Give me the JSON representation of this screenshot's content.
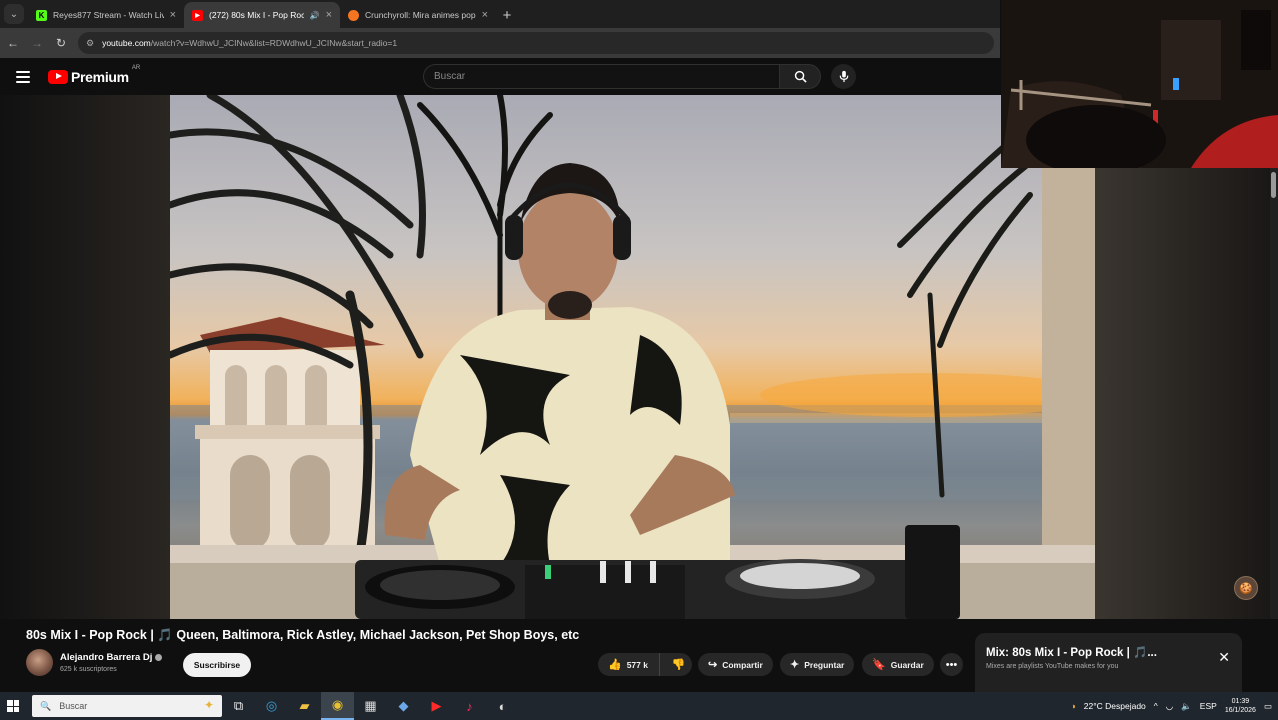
{
  "browser": {
    "tabs": [
      {
        "title": "Reyes877 Stream - Watch Live o",
        "favicon": "kick-icon",
        "active": false
      },
      {
        "title": "(272) 80s Mix I - Pop Rock |",
        "favicon": "youtube-icon",
        "active": true
      },
      {
        "title": "Crunchyroll: Mira animes popu",
        "favicon": "crunchyroll-icon",
        "active": false
      }
    ],
    "url_host": "youtube.com",
    "url_rest": "/watch?v=WdhwU_JCINw&list=RDWdhwU_JCINw&start_radio=1"
  },
  "youtube": {
    "brand": "Premium",
    "region": "AR",
    "search_placeholder": "Buscar"
  },
  "video": {
    "title": "80s Mix I - Pop Rock | 🎵 Queen, Baltimora, Rick Astley, Michael Jackson, Pet Shop Boys, etc",
    "channel": "Alejandro Barrera Dj",
    "subscribers": "625 k suscriptores",
    "subscribe_label": "Suscribirse",
    "likes": "577 k",
    "share_label": "Compartir",
    "ask_label": "Preguntar",
    "save_label": "Guardar"
  },
  "mix_panel": {
    "title": "Mix: 80s Mix I - Pop Rock | 🎵...",
    "subtitle": "Mixes are playlists YouTube makes for you"
  },
  "taskbar": {
    "search_placeholder": "Buscar",
    "weather": "22°C  Despejado",
    "language": "ESP",
    "time": "01:39",
    "date": "16/1/2026"
  },
  "colors": {
    "youtube_red": "#ff0000",
    "background": "#0f0f0f",
    "pill": "#272727"
  }
}
